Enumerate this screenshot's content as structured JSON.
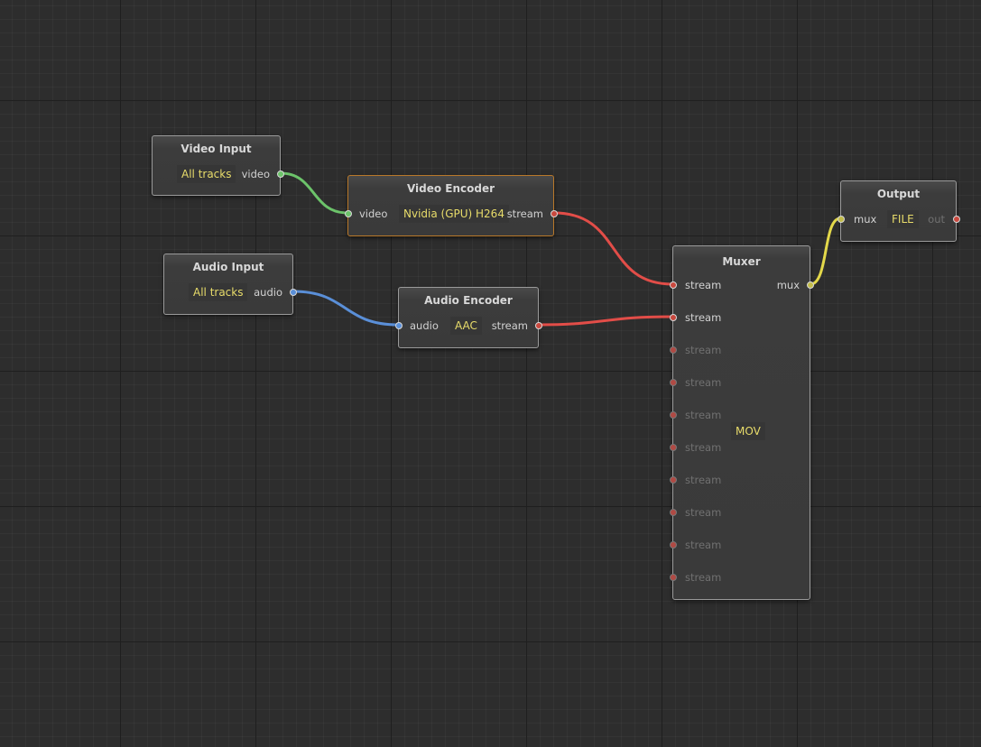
{
  "colors": {
    "video_wire": "#6cc36a",
    "audio_wire": "#5a8fd8",
    "stream_wire": "#e24d48",
    "mux_wire": "#e3d84a",
    "value_text": "#e8dc6a",
    "selected_border": "#b8782a"
  },
  "nodes": {
    "video_input": {
      "title": "Video Input",
      "value": "All tracks",
      "output": "video"
    },
    "audio_input": {
      "title": "Audio Input",
      "value": "All tracks",
      "output": "audio"
    },
    "video_encoder": {
      "title": "Video Encoder",
      "input": "video",
      "value": "Nvidia (GPU) H264",
      "output": "stream"
    },
    "audio_encoder": {
      "title": "Audio Encoder",
      "input": "audio",
      "value": "AAC",
      "output": "stream"
    },
    "muxer": {
      "title": "Muxer",
      "value": "MOV",
      "output": "mux",
      "inputs": [
        "stream",
        "stream",
        "stream",
        "stream",
        "stream",
        "stream",
        "stream",
        "stream",
        "stream",
        "stream"
      ]
    },
    "output": {
      "title": "Output",
      "input": "mux",
      "value": "FILE",
      "output": "out"
    }
  }
}
